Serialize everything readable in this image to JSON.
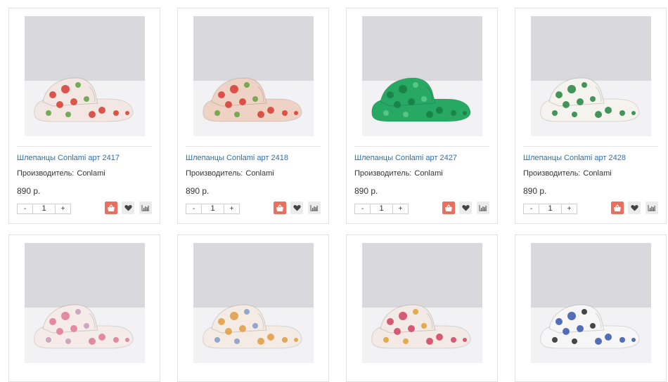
{
  "products": [
    {
      "title": "Шлепанцы Conlami арт 2417",
      "maker_label": "Производитель:",
      "maker": "Conlami",
      "price": "890 р.",
      "qty": "1",
      "minus": "-",
      "plus": "+",
      "colors": {
        "bg": "#d9d9dd",
        "floor": "#f2f2f4",
        "base": "#f3e7e3",
        "pattern": "#d7443a",
        "accent": "#6aa24a"
      }
    },
    {
      "title": "Шлепанцы Conlami арт 2418",
      "maker_label": "Производитель:",
      "maker": "Conlami",
      "price": "890 р.",
      "qty": "1",
      "minus": "-",
      "plus": "+",
      "colors": {
        "bg": "#d9d9dd",
        "floor": "#f2f2f4",
        "base": "#eed3c4",
        "pattern": "#d7443a",
        "accent": "#6aa24a"
      }
    },
    {
      "title": "Шлепанцы Conlami арт 2427",
      "maker_label": "Производитель:",
      "maker": "Conlami",
      "price": "890 р.",
      "qty": "1",
      "minus": "-",
      "plus": "+",
      "colors": {
        "bg": "#d9d9dd",
        "floor": "#f2f2f4",
        "base": "#27a964",
        "pattern": "#1a7e45",
        "accent": "#5cc98a"
      }
    },
    {
      "title": "Шлепанцы Conlami арт 2428",
      "maker_label": "Производитель:",
      "maker": "Conlami",
      "price": "890 р.",
      "qty": "1",
      "minus": "-",
      "plus": "+",
      "colors": {
        "bg": "#d9d9dd",
        "floor": "#f2f2f4",
        "base": "#f4f3ee",
        "pattern": "#2f8a48",
        "accent": "#2f8a48"
      }
    },
    {
      "colors": {
        "bg": "#d9d9dd",
        "floor": "#f2f2f4",
        "base": "#f5ecea",
        "pattern": "#e07f98",
        "accent": "#c9a0b6"
      }
    },
    {
      "colors": {
        "bg": "#d9d9dd",
        "floor": "#f2f2f4",
        "base": "#f4ece4",
        "pattern": "#e0a04a",
        "accent": "#8aa0c8"
      }
    },
    {
      "colors": {
        "bg": "#d9d9dd",
        "floor": "#f2f2f4",
        "base": "#f3e9e5",
        "pattern": "#d24a66",
        "accent": "#e3a33a"
      }
    },
    {
      "colors": {
        "bg": "#d9d9dd",
        "floor": "#f2f2f4",
        "base": "#f6f6f6",
        "pattern": "#3f5fb0",
        "accent": "#333333"
      }
    }
  ],
  "icons": {
    "cart": "basket-icon",
    "fav": "heart-icon",
    "compare": "chart-icon"
  },
  "colors": {
    "link": "#2a6fb0",
    "cart_button": "#e8705d",
    "action_button": "#ebebeb",
    "border": "#e3e3e3"
  }
}
